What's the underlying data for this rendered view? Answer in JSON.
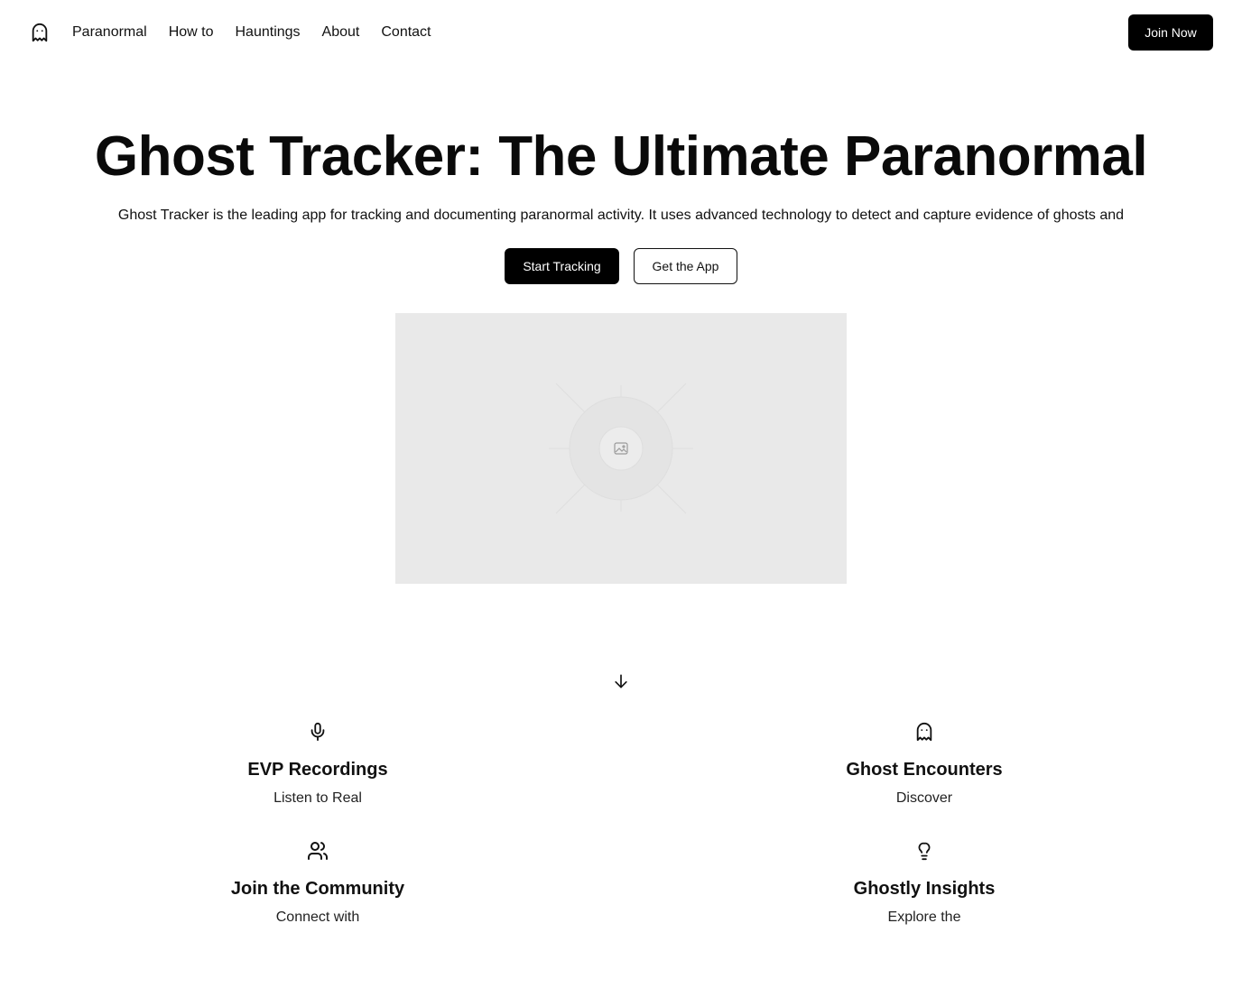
{
  "nav": {
    "logo_icon": "ghost-icon",
    "links": [
      "Paranormal",
      "How to",
      "Hauntings",
      "About",
      "Contact"
    ],
    "join_label": "Join Now"
  },
  "hero": {
    "title": "Ghost Tracker: The Ultimate Paranormal",
    "subtitle": "Ghost Tracker is the leading app for tracking and documenting paranormal activity. It uses advanced technology to detect and capture evidence of ghosts and",
    "primary_cta": "Start Tracking",
    "secondary_cta": "Get the App",
    "image_icon": "image-placeholder-icon"
  },
  "scroll_icon": "arrow-down-icon",
  "features": [
    {
      "icon": "microphone-icon",
      "title": "EVP Recordings",
      "desc": "Listen to Real"
    },
    {
      "icon": "ghost-icon",
      "title": "Ghost Encounters",
      "desc": "Discover"
    },
    {
      "icon": "users-icon",
      "title": "Join the Community",
      "desc": "Connect with"
    },
    {
      "icon": "lightbulb-icon",
      "title": "Ghostly Insights",
      "desc": "Explore the"
    }
  ],
  "colors": {
    "primary": "#000000",
    "placeholder_bg": "#e9e9e9",
    "text": "#111111"
  }
}
